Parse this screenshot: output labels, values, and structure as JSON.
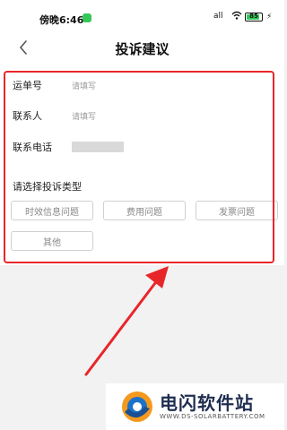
{
  "status_bar": {
    "time": "傍晚6:46",
    "signal": "all",
    "battery": "85",
    "battery_level": 0.85,
    "icons": [
      "app-dot-icon",
      "signal-icon",
      "wifi-icon",
      "battery-icon",
      "charging-icon"
    ]
  },
  "nav": {
    "title": "投诉建议",
    "back_icon": "chevron-left-icon"
  },
  "form": {
    "waybill_label": "运单号",
    "waybill_placeholder": "请填写",
    "contact_label": "联系人",
    "contact_placeholder": "请填写",
    "phone_label": "联系电话",
    "section_label": "请选择投诉类型",
    "types": [
      "时效信息问题",
      "费用问题",
      "发票问题",
      "其他"
    ]
  },
  "annotation": {
    "highlight_color": "#e8262a"
  },
  "watermark": {
    "title": "电闪软件站",
    "url": "WWW.DS-SOLARBATTERY.COM"
  }
}
